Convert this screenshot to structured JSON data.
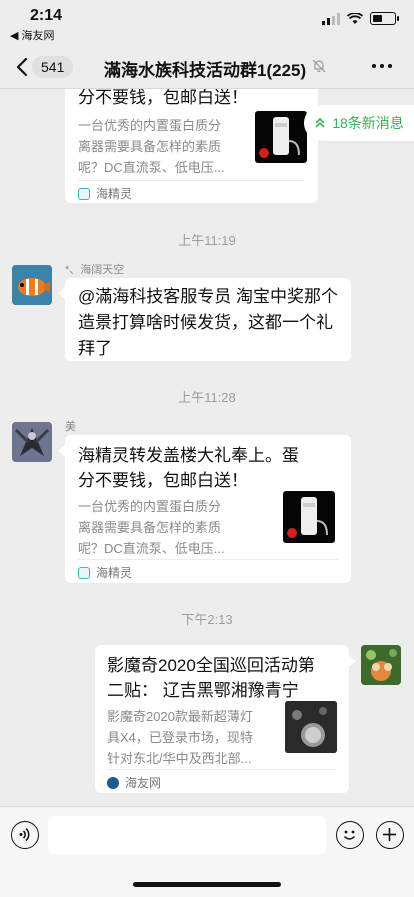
{
  "status": {
    "time": "2:14",
    "back_app": "◀ 海友网"
  },
  "nav": {
    "unread": "541",
    "title": "滿海水族科技活动群1(225)"
  },
  "new_messages": "18条新消息",
  "messages": [
    {
      "type": "link",
      "title_tail": "分不要钱，包邮白送！",
      "desc": [
        "一台优秀的内置蛋白质分",
        "离器需要具备怎样的素质",
        "呢？DC直流泵、低电压..."
      ],
      "source": "海精灵"
    },
    {
      "type": "time",
      "text": "上午11:19"
    },
    {
      "type": "text",
      "sender": "*、海阔天空",
      "lines": [
        "@滿海科技客服专员 淘宝中奖那个",
        "造景打算啥时候发货，这都一个礼",
        "拜了"
      ]
    },
    {
      "type": "time",
      "text": "上午11:28"
    },
    {
      "type": "link",
      "sender": "美",
      "title": [
        "海精灵转发盖楼大礼奉上。蛋",
        "分不要钱，包邮白送！"
      ],
      "desc": [
        "一台优秀的内置蛋白质分",
        "离器需要具备怎样的素质",
        "呢？DC直流泵、低电压..."
      ],
      "source": "海精灵"
    },
    {
      "type": "time",
      "text": "下午2:13"
    },
    {
      "type": "link",
      "self": true,
      "title": [
        "影魔奇2020全国巡回活动第",
        "二贴： 辽吉黑鄂湘豫青宁"
      ],
      "desc": [
        "影魔奇2020款最新超薄灯",
        "具X4，已登录市场，现特",
        "针对东北/华中及西北部..."
      ],
      "source": "海友网"
    }
  ],
  "icons": {
    "back": "chevron-left-icon",
    "mute": "bell-off-icon",
    "more": "more-dots-icon",
    "voice": "voice-icon",
    "emoji": "emoji-icon",
    "plus": "plus-icon",
    "double_up": "double-chevron-up-icon"
  },
  "colors": {
    "accent": "#3dae5a",
    "bg": "#ededed",
    "bubble": "#ffffff"
  }
}
